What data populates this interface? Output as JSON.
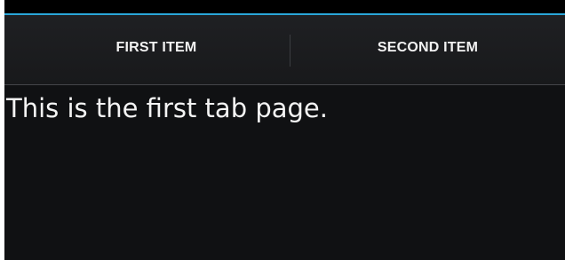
{
  "tabs": [
    {
      "label": "FIRST ITEM",
      "selected": true
    },
    {
      "label": "SECOND ITEM",
      "selected": false
    }
  ],
  "content": {
    "text": "This is the first tab page."
  },
  "colors": {
    "accent": "#2aa7d8",
    "background": "#101113",
    "tab_bar": "#1c1d20",
    "text": "#f4f4f4"
  }
}
